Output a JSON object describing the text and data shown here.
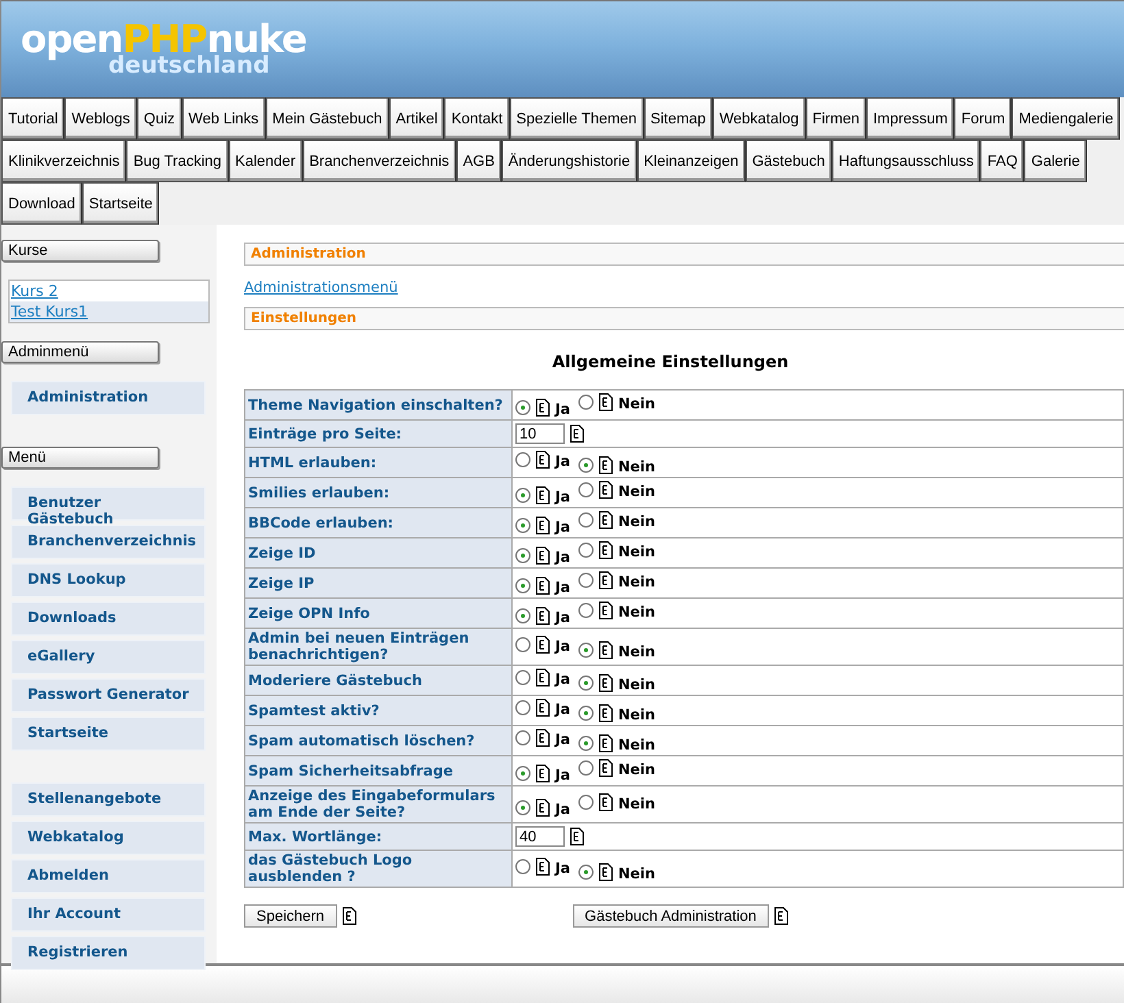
{
  "logo": {
    "part_1": "open",
    "part_2": "PHP",
    "part_3": "nuke",
    "subtitle": "deutschland"
  },
  "nav_rows": [
    [
      "Tutorial",
      "Weblogs",
      "Quiz",
      "Web Links",
      "Mein Gästebuch",
      "Artikel",
      "Kontakt",
      "Spezielle Themen",
      "Sitemap",
      "Webkatalog",
      "Firmen",
      "Impressum",
      "Forum",
      "Mediengalerie"
    ],
    [
      "Klinikverzeichnis",
      "Bug Tracking",
      "Kalender",
      "Branchenverzeichnis",
      "AGB",
      "Änderungshistorie",
      "Kleinanzeigen",
      "Gästebuch",
      "Haftungsausschluss",
      "FAQ",
      "Galerie"
    ],
    [
      "Download",
      "Startseite"
    ]
  ],
  "sidebar": {
    "blocks": [
      {
        "title": "Kurse",
        "kind": "links",
        "items": [
          "Kurs 2",
          "Test Kurs1"
        ]
      },
      {
        "title": "Adminmenü",
        "kind": "menu",
        "groups": [
          [
            "Administration"
          ]
        ]
      },
      {
        "title": "Menü",
        "kind": "menu",
        "groups": [
          [
            "Benutzer Gästebuch",
            "Branchenverzeichnis",
            "DNS Lookup",
            "Downloads",
            "eGallery",
            "Passwort Generator",
            "Startseite"
          ],
          [
            "Stellenangebote",
            "Webkatalog",
            "Abmelden",
            "Ihr Account",
            "Registrieren"
          ]
        ]
      }
    ]
  },
  "content": {
    "section_title": "Administration",
    "menu_link": "Administrationsmenü",
    "subsection_title": "Einstellungen",
    "form_title": "Allgemeine Einstellungen",
    "rows": [
      {
        "label": "Theme Navigation einschalten?",
        "kind": "radio",
        "options": [
          {
            "label": "Ja",
            "selected": true
          },
          {
            "label": "Nein",
            "selected": false
          }
        ]
      },
      {
        "label": "Einträge pro Seite:",
        "kind": "input",
        "value": "10"
      },
      {
        "label": "HTML erlauben:",
        "kind": "radio",
        "options": [
          {
            "label": "Ja",
            "selected": false
          },
          {
            "label": "Nein",
            "selected": true
          }
        ]
      },
      {
        "label": "Smilies erlauben:",
        "kind": "radio",
        "options": [
          {
            "label": "Ja",
            "selected": true
          },
          {
            "label": "Nein",
            "selected": false
          }
        ]
      },
      {
        "label": "BBCode erlauben:",
        "kind": "radio",
        "options": [
          {
            "label": "Ja",
            "selected": true
          },
          {
            "label": "Nein",
            "selected": false
          }
        ]
      },
      {
        "label": "Zeige ID",
        "kind": "radio",
        "options": [
          {
            "label": "Ja",
            "selected": true
          },
          {
            "label": "Nein",
            "selected": false
          }
        ]
      },
      {
        "label": "Zeige IP",
        "kind": "radio",
        "options": [
          {
            "label": "Ja",
            "selected": true
          },
          {
            "label": "Nein",
            "selected": false
          }
        ]
      },
      {
        "label": "Zeige OPN Info",
        "kind": "radio",
        "options": [
          {
            "label": "Ja",
            "selected": true
          },
          {
            "label": "Nein",
            "selected": false
          }
        ]
      },
      {
        "label": "Admin bei neuen Einträgen benachrichtigen?",
        "kind": "radio",
        "options": [
          {
            "label": "Ja",
            "selected": false
          },
          {
            "label": "Nein",
            "selected": true
          }
        ]
      },
      {
        "label": "Moderiere Gästebuch",
        "kind": "radio",
        "options": [
          {
            "label": "Ja",
            "selected": false
          },
          {
            "label": "Nein",
            "selected": true
          }
        ]
      },
      {
        "label": "Spamtest aktiv?",
        "kind": "radio",
        "options": [
          {
            "label": "Ja",
            "selected": false
          },
          {
            "label": "Nein",
            "selected": true
          }
        ]
      },
      {
        "label": "Spam automatisch löschen?",
        "kind": "radio",
        "options": [
          {
            "label": "Ja",
            "selected": false
          },
          {
            "label": "Nein",
            "selected": true
          }
        ]
      },
      {
        "label": "Spam Sicherheitsabfrage",
        "kind": "radio",
        "options": [
          {
            "label": "Ja",
            "selected": true
          },
          {
            "label": "Nein",
            "selected": false
          }
        ]
      },
      {
        "label": "Anzeige des Eingabeformulars am Ende der Seite?",
        "kind": "radio",
        "options": [
          {
            "label": "Ja",
            "selected": true
          },
          {
            "label": "Nein",
            "selected": false
          }
        ]
      },
      {
        "label": "Max. Wortlänge:",
        "kind": "input",
        "value": "40"
      },
      {
        "label": "das Gästebuch Logo ausblenden ?",
        "kind": "radio",
        "options": [
          {
            "label": "Ja",
            "selected": false
          },
          {
            "label": "Nein",
            "selected": true
          }
        ]
      }
    ],
    "buttons": [
      "Speichern",
      "Gästebuch Administration"
    ]
  }
}
